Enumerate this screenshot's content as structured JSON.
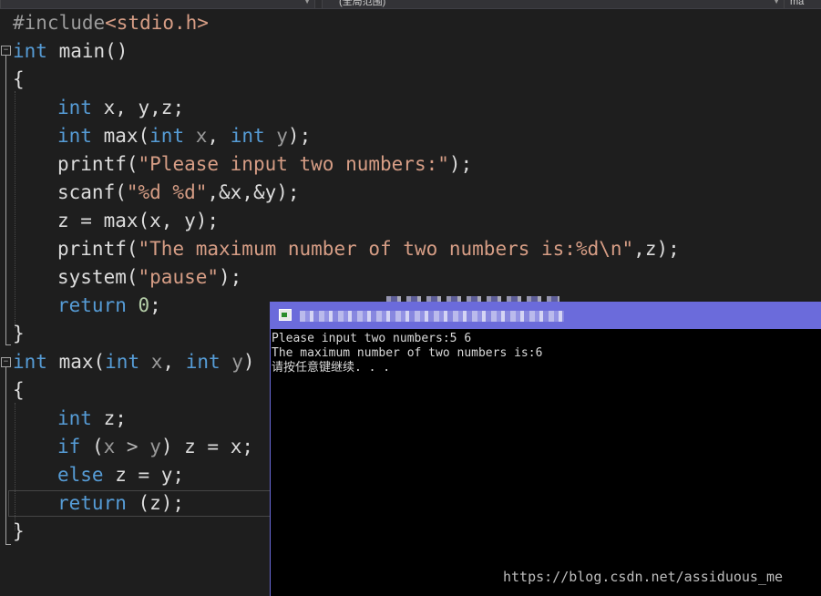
{
  "toolbar": {
    "scope_dropdown": "",
    "members_dropdown": "(全局范围)",
    "function_dropdown": "ma"
  },
  "code": {
    "l1": {
      "pre": "#include",
      "inc": "<stdio.h>"
    },
    "l2": {
      "kw": "int",
      "rest": " main()"
    },
    "l3": {
      "text": "{"
    },
    "l4": {
      "kw": "int",
      "rest": " x, y,z;"
    },
    "l5": {
      "kw1": "int",
      "fn": " max(",
      "kw2": "int",
      "p1": " x",
      "sep": ", ",
      "kw3": "int",
      "p2": " y",
      "end": ");"
    },
    "l6": {
      "fn": "printf(",
      "str": "\"Please input two numbers:\"",
      "end": ");"
    },
    "l7": {
      "fn": "scanf(",
      "str": "\"%d %d\"",
      "end": ",&x,&y);"
    },
    "l8": {
      "text": "z = max(x, y);"
    },
    "l9": {
      "fn": "printf(",
      "str": "\"The maximum number of two numbers is:%d\\n\"",
      "end": ",z);"
    },
    "l10": {
      "fn": "system(",
      "str": "\"pause\"",
      "end": ");"
    },
    "l11": {
      "kw": "return",
      "num": " 0",
      "end": ";"
    },
    "l12": {
      "text": "}"
    },
    "l13": {
      "kw1": "int",
      "fn": " max(",
      "kw2": "int",
      "p1": " x",
      "sep": ", ",
      "kw3": "int",
      "p2": " y",
      "end": ")"
    },
    "l14": {
      "text": "{"
    },
    "l15": {
      "kw": "int",
      "rest": " z;"
    },
    "l16": {
      "kw": "if",
      "a": " (",
      "p1": "x",
      "op": " > ",
      "p2": "y",
      "b": ") z = x;"
    },
    "l17": {
      "kw": "else",
      "rest": " z = y;"
    },
    "l18": {
      "kw": "return",
      "rest": " (z);"
    },
    "l19": {
      "text": "}"
    }
  },
  "console": {
    "line1": "Please input two numbers:5 6",
    "line2": "The maximum number of two numbers is:6",
    "line3": "请按任意键继续. . ."
  },
  "watermark": "https://blog.csdn.net/assiduous_me"
}
